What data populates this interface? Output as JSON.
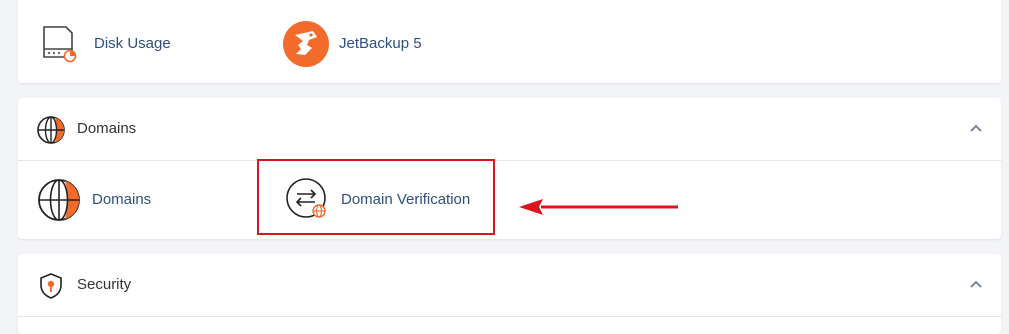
{
  "top_section": {
    "items": [
      {
        "label": "Disk Usage",
        "icon": "disk-usage-icon"
      },
      {
        "label": "JetBackup 5",
        "icon": "jetbackup-logo-icon"
      }
    ]
  },
  "domains_section": {
    "title": "Domains",
    "icon": "globe-icon",
    "collapse_icon": "chevron-up-icon",
    "items": [
      {
        "label": "Domains",
        "icon": "globe-icon"
      },
      {
        "label": "Domain Verification",
        "icon": "domain-verification-icon"
      }
    ]
  },
  "security_section": {
    "title": "Security",
    "icon": "shield-icon",
    "collapse_icon": "chevron-up-icon"
  },
  "colors": {
    "accent_orange": "#f26b2a",
    "link_blue": "#2f4f7f",
    "annotation_red": "#d9161b"
  }
}
